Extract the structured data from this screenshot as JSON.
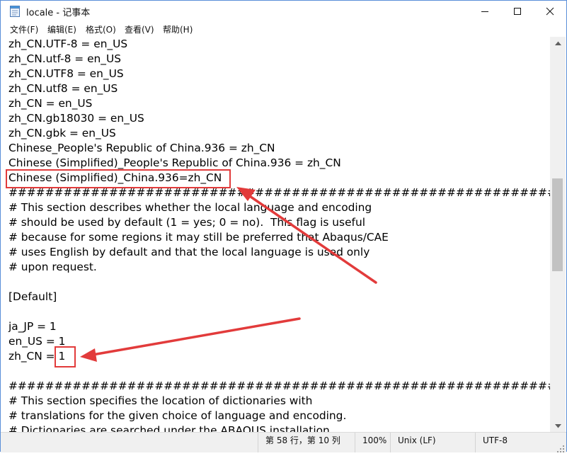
{
  "window": {
    "title": "locale - 记事本"
  },
  "menu": [
    "文件(F)",
    "编辑(E)",
    "格式(O)",
    "查看(V)",
    "帮助(H)"
  ],
  "lines": [
    "zh_CN.UTF-8 = en_US",
    "zh_CN.utf-8 = en_US",
    "zh_CN.UTF8 = en_US",
    "zh_CN.utf8 = en_US",
    "zh_CN = en_US",
    "zh_CN.gb18030 = en_US",
    "zh_CN.gbk = en_US",
    "Chinese_People's Republic of China.936 = zh_CN",
    "Chinese (Simplified)_People's Republic of China.936 = zh_CN",
    "Chinese (Simplified)_China.936=zh_CN",
    "##################################################################",
    "# This section describes whether the local language and encoding",
    "# should be used by default (1 = yes; 0 = no).  This flag is useful",
    "# because for some regions it may still be preferred that Abaqus/CAE",
    "# uses English by default and that the local language is used only",
    "# upon request.",
    "",
    "[Default]",
    "",
    "ja_JP = 1",
    "en_US = 1",
    "zh_CN = 1",
    "",
    "##################################################################",
    "# This section specifies the location of dictionaries with",
    "# translations for the given choice of language and encoding.",
    "# Dictionaries are searched under the ABAQUS installation"
  ],
  "status": {
    "position": "第 58 行，第 10 列",
    "zoom": "100%",
    "line_ending": "Unix (LF)",
    "encoding": "UTF-8"
  },
  "colors": {
    "annotation": "#e23b3b",
    "accent": "#5a8fd8"
  },
  "icons": {
    "app": "notepad-icon",
    "minimize": "minimize-icon",
    "maximize": "maximize-icon",
    "close": "close-icon",
    "scroll_up": "scroll-up-arrow-icon",
    "scroll_down": "scroll-down-arrow-icon"
  }
}
